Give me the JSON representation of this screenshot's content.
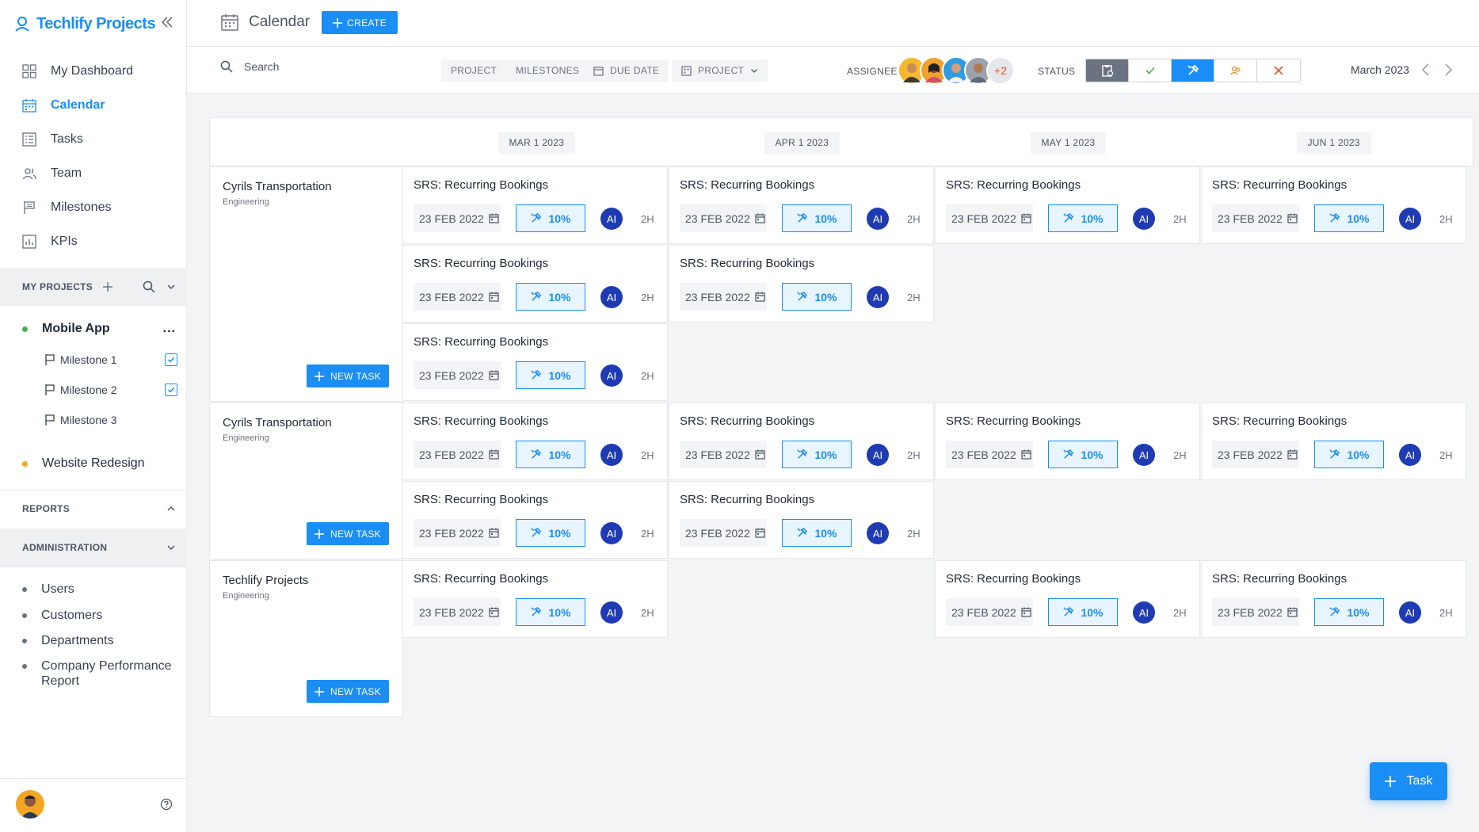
{
  "app": {
    "name": "Techlify Projects"
  },
  "nav": [
    {
      "label": "My Dashboard",
      "icon": "dashboard-icon",
      "active": false
    },
    {
      "label": "Calendar",
      "icon": "calendar-icon",
      "active": true
    },
    {
      "label": "Tasks",
      "icon": "tasks-icon",
      "active": false
    },
    {
      "label": "Team",
      "icon": "team-icon",
      "active": false
    },
    {
      "label": "Milestones",
      "icon": "flag-icon",
      "active": false
    },
    {
      "label": "KPIs",
      "icon": "kpi-icon",
      "active": false
    }
  ],
  "my_projects": {
    "title": "MY PROJECTS",
    "projects": [
      {
        "name": "Mobile App",
        "color": "#4caf50",
        "menu": "..."
      },
      {
        "name": "Website Redesign",
        "color": "#f5a524"
      }
    ],
    "milestones": [
      {
        "label": "Milestone 1",
        "checked": true
      },
      {
        "label": "Milestone 2",
        "checked": true
      },
      {
        "label": "Milestone 3",
        "checked": false
      }
    ]
  },
  "reports": {
    "title": "REPORTS"
  },
  "administration": {
    "title": "ADMINISTRATION",
    "items": [
      {
        "label": "Users"
      },
      {
        "label": "Customers"
      },
      {
        "label": "Departments"
      },
      {
        "label": "Company Performance Report"
      }
    ]
  },
  "header": {
    "title": "Calendar",
    "create_label": "CREATE"
  },
  "filters": {
    "search_placeholder": "Search",
    "view_toggle": [
      "PROJECT",
      "MILESTONES"
    ],
    "due_date_label": "DUE DATE",
    "project_label": "PROJECT",
    "assignee_label": "ASSIGNEE",
    "assignee_more": "+2",
    "status_label": "STATUS",
    "status_options": [
      {
        "name": "pending-status",
        "active": "dark"
      },
      {
        "name": "done-status",
        "active": "none"
      },
      {
        "name": "in-progress-status",
        "active": "blue"
      },
      {
        "name": "assigned-status",
        "active": "none"
      },
      {
        "name": "cancelled-status",
        "active": "none"
      }
    ],
    "current_month": "March 2023"
  },
  "colors": {
    "primary": "#1a8ef5",
    "avatar_blue": "#1f3bb3",
    "status_dark": "#6b7280",
    "cancel_red": "#e4572e",
    "done_green": "#4caf50"
  },
  "calendar": {
    "months": [
      "MAR 1 2023",
      "APR 1 2023",
      "MAY 1 2023",
      "JUN 1 2023"
    ],
    "new_task_label": "NEW TASK",
    "rows": [
      {
        "project": "Cyrils Transportation",
        "department": "Engineering",
        "sub_rows": 3,
        "tasks": [
          {
            "col": 0,
            "sub": 0
          },
          {
            "col": 1,
            "sub": 0
          },
          {
            "col": 2,
            "sub": 0
          },
          {
            "col": 3,
            "sub": 0
          },
          {
            "col": 0,
            "sub": 1
          },
          {
            "col": 1,
            "sub": 1
          },
          {
            "col": 0,
            "sub": 2
          }
        ]
      },
      {
        "project": "Cyrils Transportation",
        "department": "Engineering",
        "sub_rows": 2,
        "tasks": [
          {
            "col": 0,
            "sub": 0
          },
          {
            "col": 1,
            "sub": 0
          },
          {
            "col": 2,
            "sub": 0
          },
          {
            "col": 3,
            "sub": 0
          },
          {
            "col": 0,
            "sub": 1
          },
          {
            "col": 1,
            "sub": 1
          }
        ]
      },
      {
        "project": "Techlify Projects",
        "department": "Engineering",
        "sub_rows": 2,
        "tasks": [
          {
            "col": 0,
            "sub": 0
          },
          {
            "col": 2,
            "sub": 0
          },
          {
            "col": 3,
            "sub": 0
          }
        ]
      }
    ],
    "task_template": {
      "title": "SRS: Recurring Bookings",
      "date": "23 FEB 2022",
      "progress": "10%",
      "assignee_initials": "AI",
      "duration": "2H"
    }
  },
  "fab": {
    "label": "Task"
  }
}
